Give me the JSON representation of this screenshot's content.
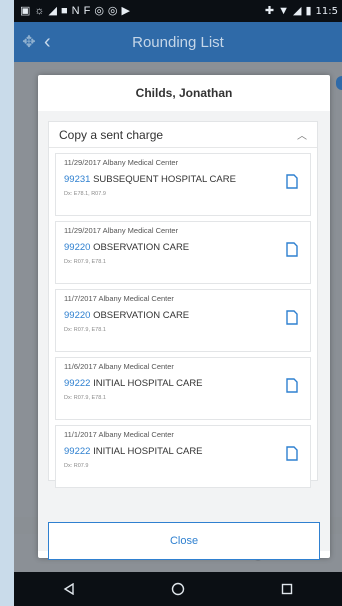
{
  "status_bar": {
    "time": "11:5"
  },
  "app_bar": {
    "title": "Rounding List"
  },
  "modal": {
    "patient_name": "Childs, Jonathan",
    "section_title": "Copy a sent charge",
    "items": [
      {
        "date_location": "11/29/2017 Albany Medical Center",
        "code": "99231",
        "description": "SUBSEQUENT HOSPITAL CARE",
        "dx": "Dx: E78.1, R07.9"
      },
      {
        "date_location": "11/29/2017 Albany Medical Center",
        "code": "99220",
        "description": "OBSERVATION CARE",
        "dx": "Dx: R07.9, E78.1"
      },
      {
        "date_location": "11/7/2017 Albany Medical Center",
        "code": "99220",
        "description": "OBSERVATION CARE",
        "dx": "Dx: R07.9, E78.1"
      },
      {
        "date_location": "11/6/2017 Albany Medical Center",
        "code": "99222",
        "description": "INITIAL HOSPITAL CARE",
        "dx": "Dx: R07.9, E78.1"
      },
      {
        "date_location": "11/1/2017 Albany Medical Center",
        "code": "99222",
        "description": "INITIAL HOSPITAL CARE",
        "dx": "Dx: R07.9"
      }
    ],
    "close_label": "Close"
  },
  "icons": {
    "app_bar": [
      "navigation-icon",
      "back-arrow-icon"
    ],
    "item_action": "copy-document-icon",
    "bottom_tabs": [
      "hospital-bed-icon",
      "logout-icon"
    ],
    "system_nav": [
      "back-triangle-icon",
      "home-circle-icon",
      "recents-square-icon"
    ]
  },
  "colors": {
    "app_bar": "#2f6aa8",
    "accent": "#2f80d0",
    "overlay": "#8b9096"
  }
}
